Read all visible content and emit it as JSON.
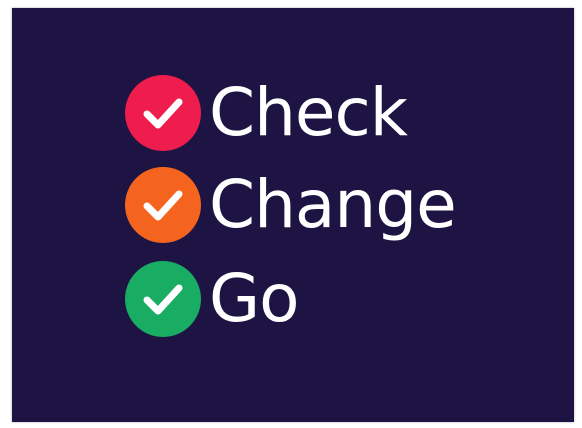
{
  "colors": {
    "background": "#1e1444",
    "check": "#ee1d4e",
    "change": "#f5641e",
    "go": "#19ad64",
    "text": "#ffffff"
  },
  "items": [
    {
      "label": "Check",
      "icon": "checkmark-icon",
      "color": "#ee1d4e"
    },
    {
      "label": "Change",
      "icon": "checkmark-icon",
      "color": "#f5641e"
    },
    {
      "label": "Go",
      "icon": "checkmark-icon",
      "color": "#19ad64"
    }
  ]
}
